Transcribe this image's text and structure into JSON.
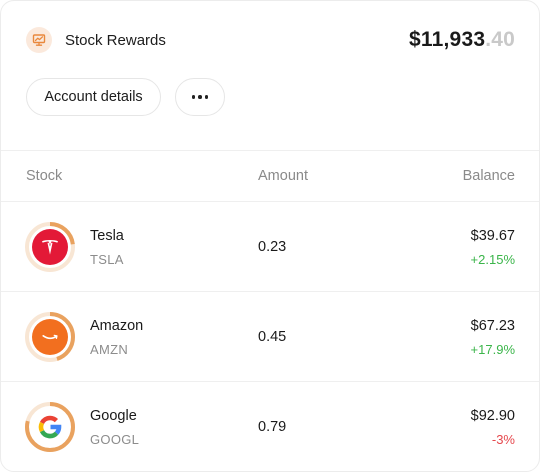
{
  "header": {
    "title": "Stock Rewards",
    "total_main": "$11,933",
    "total_cents": ".40",
    "account_details_label": "Account details",
    "more_icon": "more-horizontal-icon",
    "title_icon": "chart-presentation-icon"
  },
  "table": {
    "columns": [
      "Stock",
      "Amount",
      "Balance"
    ],
    "rows": [
      {
        "name": "Tesla",
        "ticker": "TSLA",
        "amount": "0.23",
        "balance": "$39.67",
        "change": "+2.15%",
        "change_color": "#3bb54a",
        "logo": "tesla-logo",
        "ring_fraction": 0.23
      },
      {
        "name": "Amazon",
        "ticker": "AMZN",
        "amount": "0.45",
        "balance": "$67.23",
        "change": "+17.9%",
        "change_color": "#3bb54a",
        "logo": "amazon-logo",
        "ring_fraction": 0.45
      },
      {
        "name": "Google",
        "ticker": "GOOGL",
        "amount": "0.79",
        "balance": "$92.90",
        "change": "-3%",
        "change_color": "#e5484d",
        "logo": "google-logo",
        "ring_fraction": 0.79
      }
    ]
  },
  "colors": {
    "accent": "#e9a25f",
    "ring_track": "#f8e6d4",
    "tesla": "#e31937",
    "amazon": "#f26f1f",
    "positive": "#3bb54a",
    "negative": "#e5484d"
  }
}
